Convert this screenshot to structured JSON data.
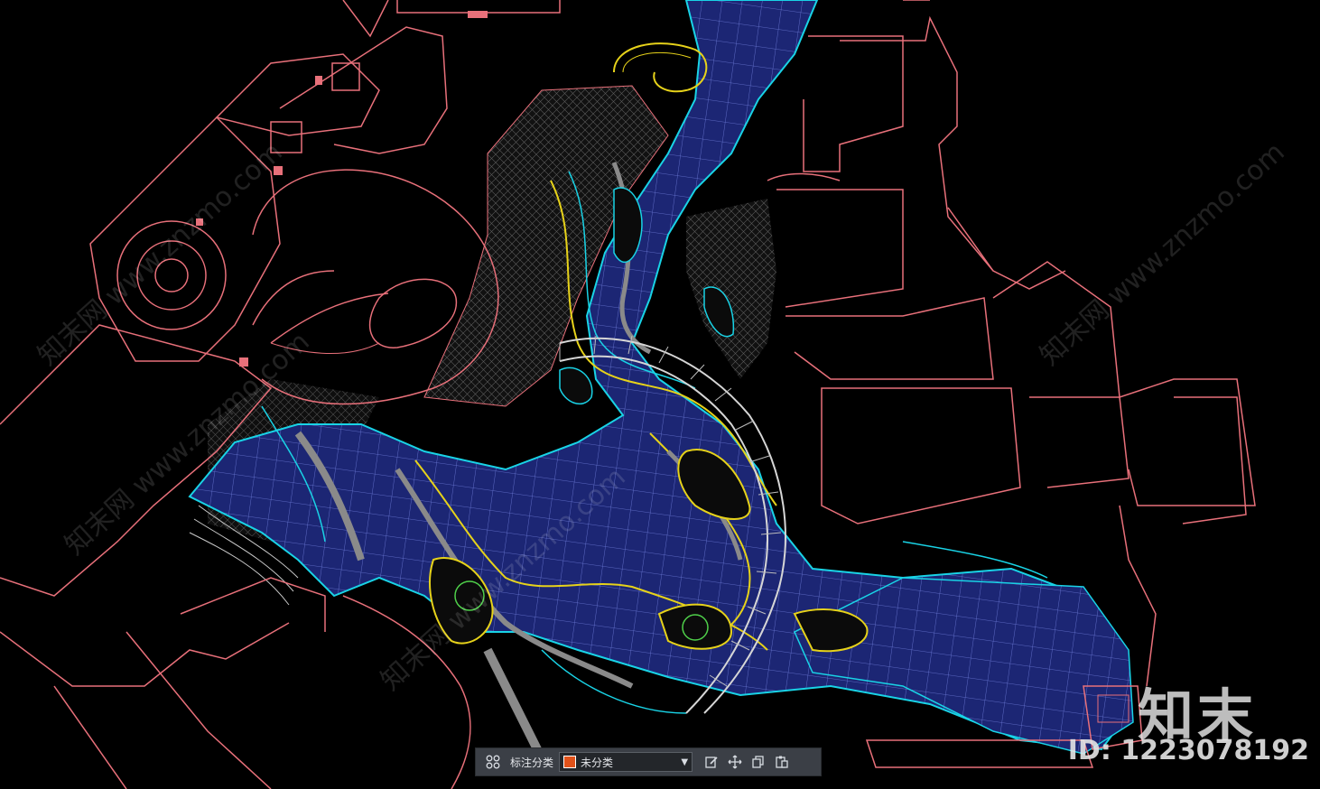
{
  "watermarks": {
    "site_text": "知末网 www.znzmo.com",
    "logo_text": "知末",
    "id_text": "ID: 1223078192"
  },
  "toolbar": {
    "grid_icon": "grid-icon",
    "category_label": "标注分类",
    "category_value": "未分类",
    "category_color": "#e0521a",
    "edit_icon": "edit-icon",
    "move_icon": "move-icon",
    "copy_icon": "copy-icon",
    "paste_icon": "paste-icon"
  },
  "colors": {
    "background": "#000000",
    "building_lines": "#e8707a",
    "water_fill": "#1e2a78",
    "contour_gray": "#8a8a8a",
    "edge_cyan": "#19d3e6",
    "edge_yellow": "#e6d21a",
    "edge_green": "#4fd04a",
    "path_white": "#d6d6d6"
  }
}
